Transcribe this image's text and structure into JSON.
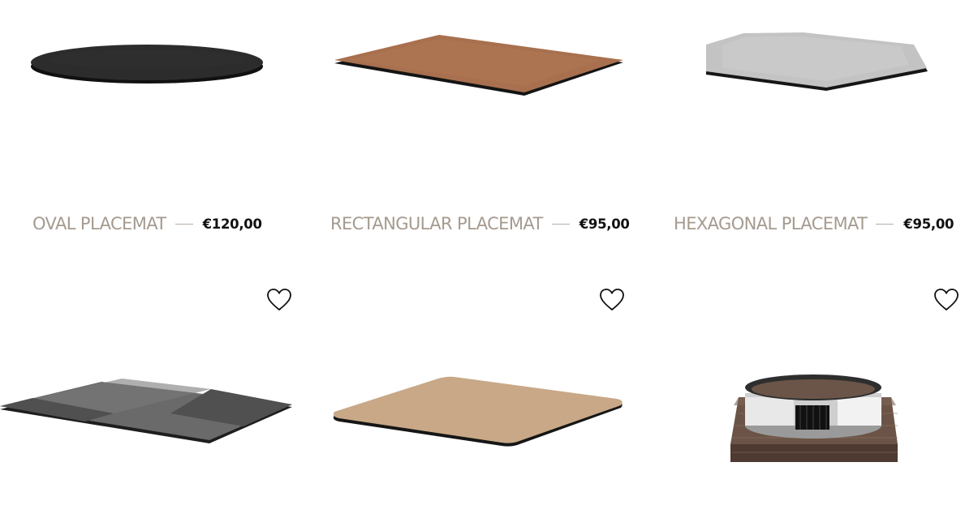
{
  "products": [
    {
      "name": "OVAL PLACEMAT",
      "price": "€120,00"
    },
    {
      "name": "RECTANGULAR PLACEMAT",
      "price": "€95,00"
    },
    {
      "name": "HEXAGONAL PLACEMAT",
      "price": "€95,00"
    },
    {
      "name": "",
      "price": ""
    },
    {
      "name": "",
      "price": ""
    },
    {
      "name": "",
      "price": ""
    }
  ],
  "icons": {
    "wishlist": "heart-outline-icon"
  },
  "colors": {
    "name_text": "#a59a8f",
    "price_text": "#111111",
    "black_leather": "#2b2b2b",
    "copper_leather": "#a9704f",
    "silver": "#c8c8c8",
    "gray_leather": "#6f6f6f",
    "beige_leather": "#c9a987",
    "bronze": "#6a5245"
  }
}
